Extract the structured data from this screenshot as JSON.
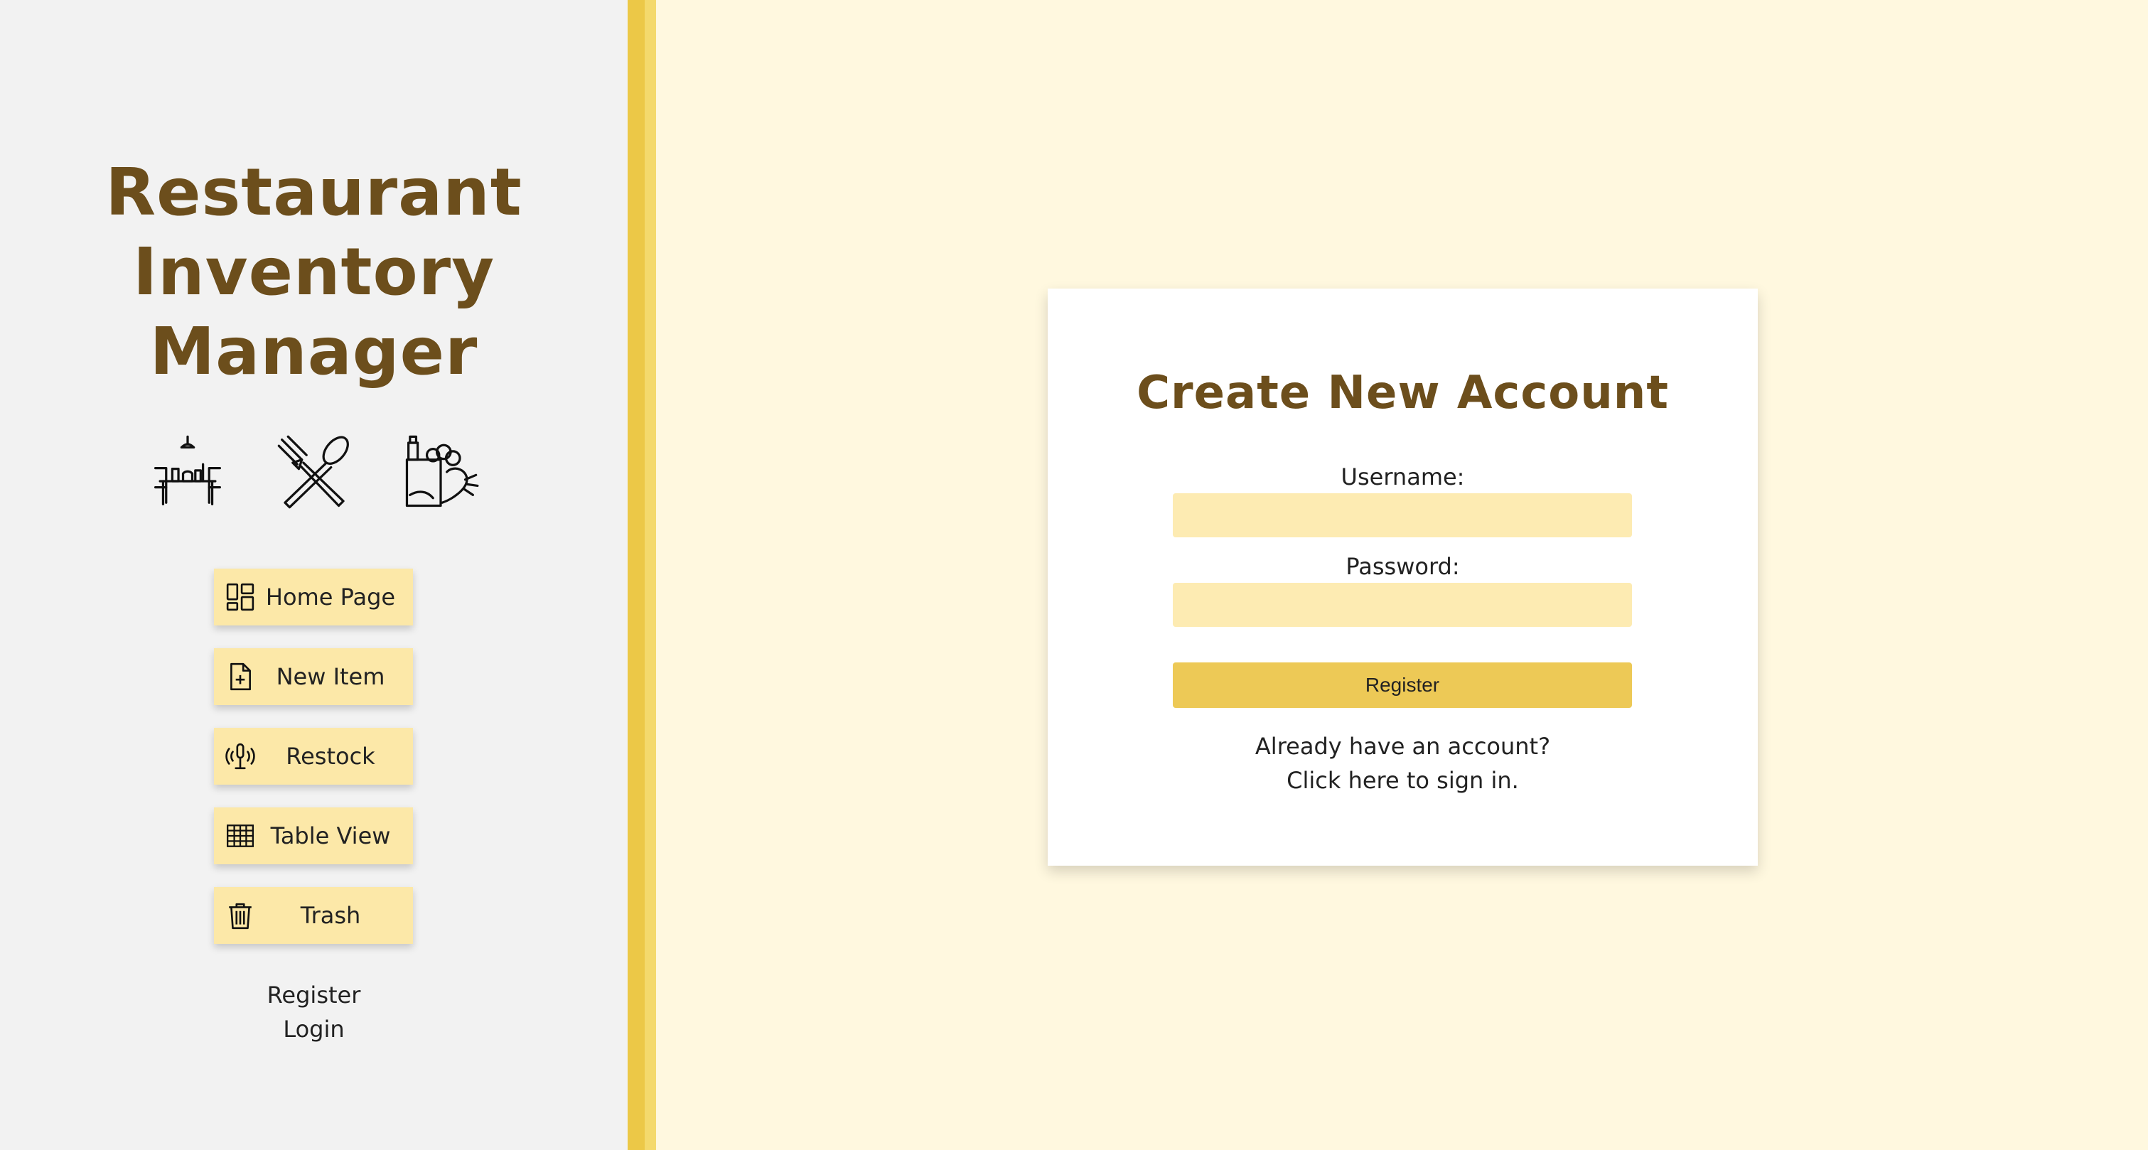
{
  "sidebar": {
    "title_lines": [
      "Restaurant",
      "Inventory",
      "Manager"
    ],
    "hero_icons": [
      "dining-table-icon",
      "fork-spoon-icon",
      "groceries-icon"
    ],
    "nav_items": [
      {
        "label": "Home Page",
        "icon": "dashboard-icon"
      },
      {
        "label": "New Item",
        "icon": "file-plus-icon"
      },
      {
        "label": "Restock",
        "icon": "restock-signal-icon"
      },
      {
        "label": "Table View",
        "icon": "table-grid-icon"
      },
      {
        "label": "Trash",
        "icon": "trash-icon"
      }
    ],
    "links": {
      "register": "Register",
      "login": "Login"
    }
  },
  "form": {
    "title": "Create New Account",
    "username_label": "Username:",
    "username_value": "",
    "password_label": "Password:",
    "password_value": "",
    "submit_label": "Register",
    "signin_line1": "Already have an account?",
    "signin_line2": "Click here to sign in."
  },
  "colors": {
    "brand_brown": "#6c4e1c",
    "main_background": "#fff8df",
    "sidebar_background": "#f2f2f2",
    "nav_button": "#fce8a8",
    "input_background": "#fdebb2",
    "register_button": "#edc956",
    "divider": "#ecc847"
  }
}
